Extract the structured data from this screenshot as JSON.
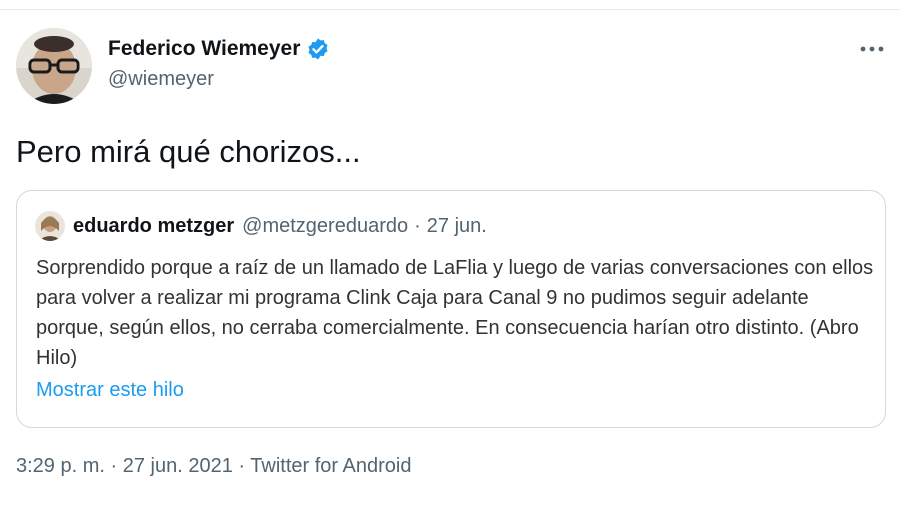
{
  "author": {
    "name": "Federico Wiemeyer",
    "handle": "@wiemeyer",
    "verified": true
  },
  "tweet": {
    "text": "Pero mirá qué chorizos..."
  },
  "quoted_tweet": {
    "name": "eduardo metzger",
    "handle": "@metzgereduardo",
    "separator": "·",
    "date": "27 jun.",
    "body": "Sorprendido porque a raíz de un llamado de LaFlia y luego de varias conversaciones con ellos para volver a realizar mi programa Clink Caja para Canal 9 no pudimos seguir adelante porque, según ellos, no cerraba comercialmente. En consecuencia harían otro distinto. (Abro Hilo)",
    "show_thread": "Mostrar este hilo"
  },
  "meta": {
    "time": "3:29 p. m.",
    "separator": "·",
    "date": "27 jun. 2021",
    "source": "Twitter for Android"
  },
  "colors": {
    "link": "#1d9bf0",
    "verified": "#1d9bf0",
    "secondary_text": "#536471",
    "border": "#cfd9de"
  },
  "icons": {
    "verified": "verified-badge-icon",
    "more": "more-horizontal-icon"
  }
}
